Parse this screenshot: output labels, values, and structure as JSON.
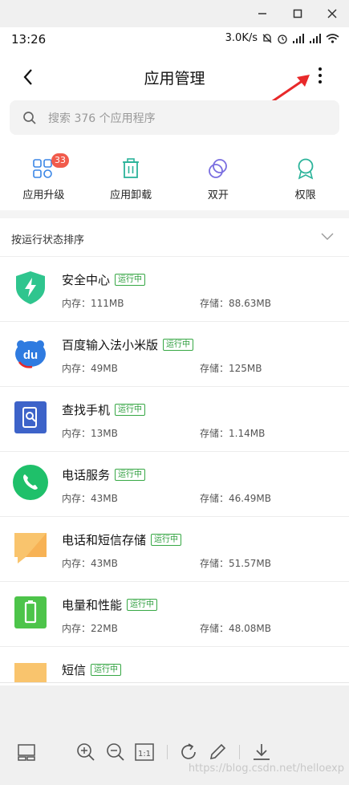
{
  "window": {
    "minimize_icon": "minimize-icon",
    "maximize_icon": "maximize-icon",
    "close_icon": "close-icon"
  },
  "status_bar": {
    "time": "13:26",
    "speed": "3.0K/s"
  },
  "header": {
    "title": "应用管理",
    "back_icon": "chevron-left-icon",
    "more_icon": "more-vertical-icon"
  },
  "search": {
    "placeholder": "搜索 376 个应用程序"
  },
  "tools": [
    {
      "label": "应用升级",
      "icon": "app-grid-icon",
      "badge": "33"
    },
    {
      "label": "应用卸载",
      "icon": "trash-icon"
    },
    {
      "label": "双开",
      "icon": "dual-circle-icon"
    },
    {
      "label": "权限",
      "icon": "ribbon-icon"
    }
  ],
  "sort": {
    "label": "按运行状态排序"
  },
  "apps": [
    {
      "name": "安全中心",
      "status": "运行中",
      "memory": "内存：111MB",
      "storage": "存储：88.63MB",
      "icon": "shield-bolt-icon",
      "color": "#2fc58e"
    },
    {
      "name": "百度输入法小米版",
      "status": "运行中",
      "memory": "内存：49MB",
      "storage": "存储：125MB",
      "icon": "baidu-du-icon",
      "color": "#2f7be0"
    },
    {
      "name": "查找手机",
      "status": "运行中",
      "memory": "内存：13MB",
      "storage": "存储：1.14MB",
      "icon": "find-phone-icon",
      "color": "#3d63c9"
    },
    {
      "name": "电话服务",
      "status": "运行中",
      "memory": "内存：43MB",
      "storage": "存储：46.49MB",
      "icon": "phone-icon",
      "color": "#1fc06a"
    },
    {
      "name": "电话和短信存储",
      "status": "运行中",
      "memory": "内存：43MB",
      "storage": "存储：51.57MB",
      "icon": "message-bubble-icon",
      "color": "#f9c46d"
    },
    {
      "name": "电量和性能",
      "status": "运行中",
      "memory": "内存：22MB",
      "storage": "存储：48.08MB",
      "icon": "battery-icon",
      "color": "#4dc44a"
    },
    {
      "name": "短信",
      "status": "运行中",
      "memory": "",
      "storage": "",
      "icon": "sms-icon",
      "color": "#f9c46d"
    }
  ],
  "watermark": "https://blog.csdn.net/helloexp"
}
